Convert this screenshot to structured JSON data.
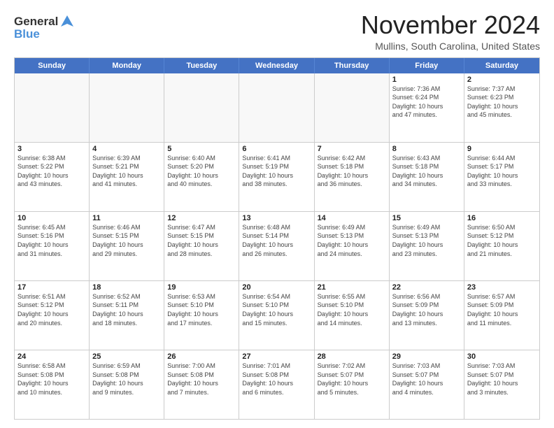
{
  "logo": {
    "general": "General",
    "blue": "Blue"
  },
  "header": {
    "month": "November 2024",
    "location": "Mullins, South Carolina, United States"
  },
  "weekdays": [
    "Sunday",
    "Monday",
    "Tuesday",
    "Wednesday",
    "Thursday",
    "Friday",
    "Saturday"
  ],
  "rows": [
    [
      {
        "day": "",
        "info": "",
        "empty": true
      },
      {
        "day": "",
        "info": "",
        "empty": true
      },
      {
        "day": "",
        "info": "",
        "empty": true
      },
      {
        "day": "",
        "info": "",
        "empty": true
      },
      {
        "day": "",
        "info": "",
        "empty": true
      },
      {
        "day": "1",
        "info": "Sunrise: 7:36 AM\nSunset: 6:24 PM\nDaylight: 10 hours\nand 47 minutes.",
        "empty": false
      },
      {
        "day": "2",
        "info": "Sunrise: 7:37 AM\nSunset: 6:23 PM\nDaylight: 10 hours\nand 45 minutes.",
        "empty": false
      }
    ],
    [
      {
        "day": "3",
        "info": "Sunrise: 6:38 AM\nSunset: 5:22 PM\nDaylight: 10 hours\nand 43 minutes.",
        "empty": false
      },
      {
        "day": "4",
        "info": "Sunrise: 6:39 AM\nSunset: 5:21 PM\nDaylight: 10 hours\nand 41 minutes.",
        "empty": false
      },
      {
        "day": "5",
        "info": "Sunrise: 6:40 AM\nSunset: 5:20 PM\nDaylight: 10 hours\nand 40 minutes.",
        "empty": false
      },
      {
        "day": "6",
        "info": "Sunrise: 6:41 AM\nSunset: 5:19 PM\nDaylight: 10 hours\nand 38 minutes.",
        "empty": false
      },
      {
        "day": "7",
        "info": "Sunrise: 6:42 AM\nSunset: 5:18 PM\nDaylight: 10 hours\nand 36 minutes.",
        "empty": false
      },
      {
        "day": "8",
        "info": "Sunrise: 6:43 AM\nSunset: 5:18 PM\nDaylight: 10 hours\nand 34 minutes.",
        "empty": false
      },
      {
        "day": "9",
        "info": "Sunrise: 6:44 AM\nSunset: 5:17 PM\nDaylight: 10 hours\nand 33 minutes.",
        "empty": false
      }
    ],
    [
      {
        "day": "10",
        "info": "Sunrise: 6:45 AM\nSunset: 5:16 PM\nDaylight: 10 hours\nand 31 minutes.",
        "empty": false
      },
      {
        "day": "11",
        "info": "Sunrise: 6:46 AM\nSunset: 5:15 PM\nDaylight: 10 hours\nand 29 minutes.",
        "empty": false
      },
      {
        "day": "12",
        "info": "Sunrise: 6:47 AM\nSunset: 5:15 PM\nDaylight: 10 hours\nand 28 minutes.",
        "empty": false
      },
      {
        "day": "13",
        "info": "Sunrise: 6:48 AM\nSunset: 5:14 PM\nDaylight: 10 hours\nand 26 minutes.",
        "empty": false
      },
      {
        "day": "14",
        "info": "Sunrise: 6:49 AM\nSunset: 5:13 PM\nDaylight: 10 hours\nand 24 minutes.",
        "empty": false
      },
      {
        "day": "15",
        "info": "Sunrise: 6:49 AM\nSunset: 5:13 PM\nDaylight: 10 hours\nand 23 minutes.",
        "empty": false
      },
      {
        "day": "16",
        "info": "Sunrise: 6:50 AM\nSunset: 5:12 PM\nDaylight: 10 hours\nand 21 minutes.",
        "empty": false
      }
    ],
    [
      {
        "day": "17",
        "info": "Sunrise: 6:51 AM\nSunset: 5:12 PM\nDaylight: 10 hours\nand 20 minutes.",
        "empty": false
      },
      {
        "day": "18",
        "info": "Sunrise: 6:52 AM\nSunset: 5:11 PM\nDaylight: 10 hours\nand 18 minutes.",
        "empty": false
      },
      {
        "day": "19",
        "info": "Sunrise: 6:53 AM\nSunset: 5:10 PM\nDaylight: 10 hours\nand 17 minutes.",
        "empty": false
      },
      {
        "day": "20",
        "info": "Sunrise: 6:54 AM\nSunset: 5:10 PM\nDaylight: 10 hours\nand 15 minutes.",
        "empty": false
      },
      {
        "day": "21",
        "info": "Sunrise: 6:55 AM\nSunset: 5:10 PM\nDaylight: 10 hours\nand 14 minutes.",
        "empty": false
      },
      {
        "day": "22",
        "info": "Sunrise: 6:56 AM\nSunset: 5:09 PM\nDaylight: 10 hours\nand 13 minutes.",
        "empty": false
      },
      {
        "day": "23",
        "info": "Sunrise: 6:57 AM\nSunset: 5:09 PM\nDaylight: 10 hours\nand 11 minutes.",
        "empty": false
      }
    ],
    [
      {
        "day": "24",
        "info": "Sunrise: 6:58 AM\nSunset: 5:08 PM\nDaylight: 10 hours\nand 10 minutes.",
        "empty": false
      },
      {
        "day": "25",
        "info": "Sunrise: 6:59 AM\nSunset: 5:08 PM\nDaylight: 10 hours\nand 9 minutes.",
        "empty": false
      },
      {
        "day": "26",
        "info": "Sunrise: 7:00 AM\nSunset: 5:08 PM\nDaylight: 10 hours\nand 7 minutes.",
        "empty": false
      },
      {
        "day": "27",
        "info": "Sunrise: 7:01 AM\nSunset: 5:08 PM\nDaylight: 10 hours\nand 6 minutes.",
        "empty": false
      },
      {
        "day": "28",
        "info": "Sunrise: 7:02 AM\nSunset: 5:07 PM\nDaylight: 10 hours\nand 5 minutes.",
        "empty": false
      },
      {
        "day": "29",
        "info": "Sunrise: 7:03 AM\nSunset: 5:07 PM\nDaylight: 10 hours\nand 4 minutes.",
        "empty": false
      },
      {
        "day": "30",
        "info": "Sunrise: 7:03 AM\nSunset: 5:07 PM\nDaylight: 10 hours\nand 3 minutes.",
        "empty": false
      }
    ]
  ]
}
